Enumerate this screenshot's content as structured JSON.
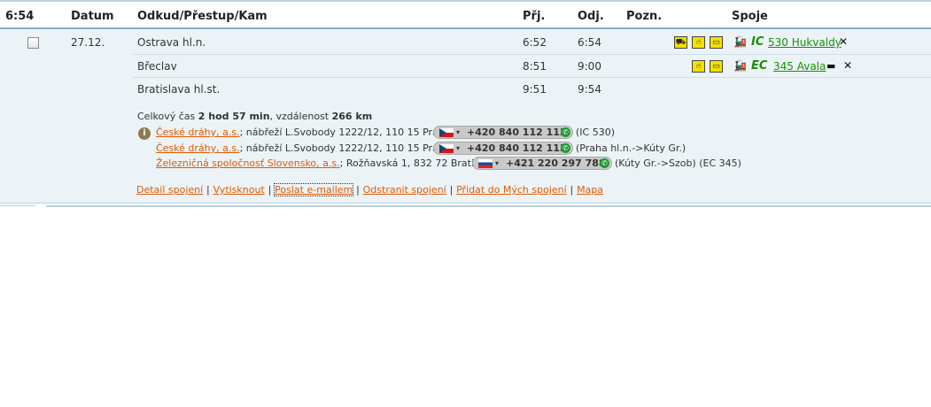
{
  "header": {
    "time": "6:54",
    "datum": "Datum",
    "route": "Odkud/Přestup/Kam",
    "arr": "Přj.",
    "dep": "Odj.",
    "note": "Pozn.",
    "conn": "Spoje"
  },
  "trip": {
    "date": "27.12.",
    "stations": [
      {
        "name": "Ostrava hl.n.",
        "arr": "6:52",
        "dep": "6:54"
      },
      {
        "name": "Břeclav",
        "arr": "8:51",
        "dep": "9:00"
      },
      {
        "name": "Bratislava hl.st.",
        "arr": "9:51",
        "dep": "9:54"
      }
    ],
    "trains": [
      {
        "type": "IC",
        "name": "530 Hukvaldy"
      },
      {
        "type": "EC",
        "name": "345 Avala"
      }
    ]
  },
  "summary": {
    "prefix": "Celkový čas ",
    "duration": "2 hod 57 min",
    "mid": ", vzdálenost ",
    "distance": "266 km"
  },
  "carriers": [
    {
      "name": "České dráhy, a.s.",
      "address": "; nábřeží L.Svobody 1222/12, 110 15 Praha 1;",
      "phone": "+420 840 112 113",
      "note": "(IC 530)"
    },
    {
      "name": "České dráhy, a.s.",
      "address": "; nábřeží L.Svobody 1222/12, 110 15 Praha 1;",
      "phone": "+420 840 112 113",
      "note": "(Praha hl.n.->Kúty Gr.)"
    },
    {
      "name": "Železničná spoločnosť Slovensko, a.s.",
      "address": "; Rožňavská 1, 832 72 Bratislava 3;",
      "phone": "+421 220 297 788",
      "note": "(Kúty Gr.->Szob) (EC 345)"
    }
  ],
  "links": {
    "detail": "Detail spojení",
    "print": "Vytisknout",
    "email": "Poslat e-mailem",
    "remove": "Odstranit spojení",
    "add": "Přidat do Mých spojení",
    "map": "Mapa"
  },
  "colors": {
    "green": "#169100",
    "orange": "#e05a00",
    "panel": "#ecf3f7"
  }
}
